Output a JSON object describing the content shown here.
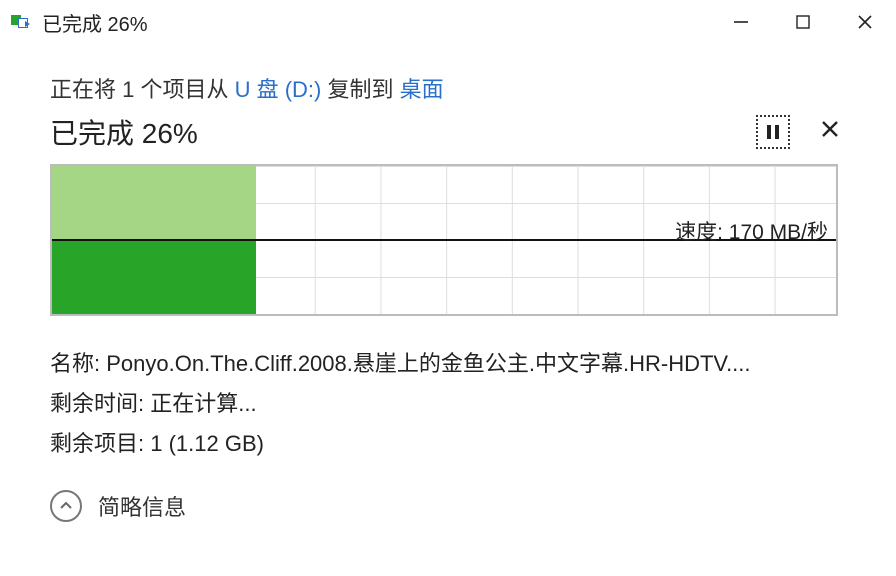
{
  "titlebar": {
    "title": "已完成 26%"
  },
  "copy_line": {
    "prefix": "正在将 1 个项目从 ",
    "source": "U 盘 (D:)",
    "mid": " 复制到 ",
    "dest": "桌面"
  },
  "progress": {
    "title": "已完成 26%",
    "percent": 26,
    "speed_label": "速度:",
    "speed_value": "170 MB/秒"
  },
  "details": {
    "name_label": "名称:",
    "name_value": "Ponyo.On.The.Cliff.2008.悬崖上的金鱼公主.中文字幕.HR-HDTV....",
    "time_label": "剩余时间:",
    "time_value": "正在计算...",
    "items_label": "剩余项目:",
    "items_value": "1 (1.12 GB)"
  },
  "footer": {
    "label": "简略信息"
  }
}
